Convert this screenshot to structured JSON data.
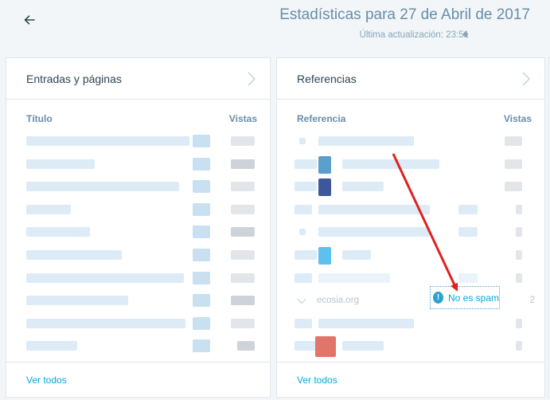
{
  "header": {
    "title": "Estadísticas para 27 de Abril de 2017",
    "subtitle": "Última actualización: 23:51"
  },
  "posts_card": {
    "title": "Entradas y páginas",
    "col_title": "Título",
    "col_views": "Vistas",
    "footer_link": "Ver todos"
  },
  "referrers_card": {
    "title": "Referencias",
    "col_referrer": "Referencia",
    "col_views": "Vistas",
    "ecosia_label": "ecosia.org",
    "ecosia_count": "2",
    "not_spam_label": "No es spam",
    "footer_link": "Ver todos"
  },
  "colors": {
    "accent": "#00aadc",
    "annotation": "#e02020"
  }
}
